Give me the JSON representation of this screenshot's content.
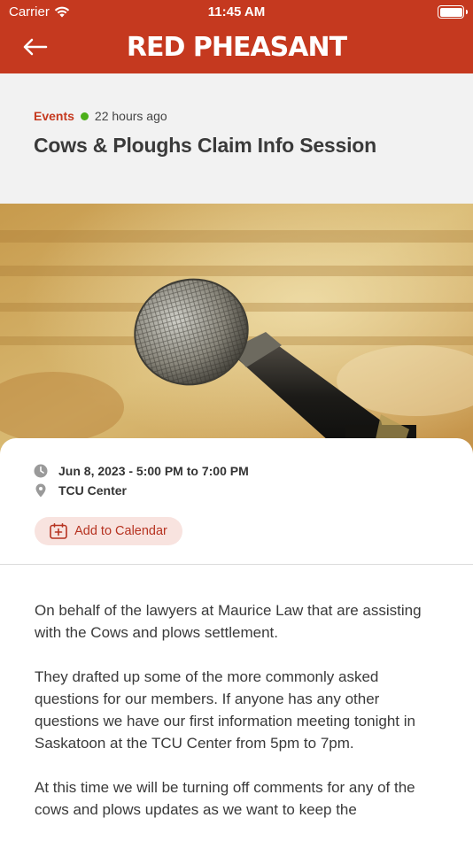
{
  "status_bar": {
    "carrier": "Carrier",
    "time": "11:45 AM"
  },
  "header": {
    "brand": "RED PHEASANT",
    "back_icon": "arrow-left-icon"
  },
  "article": {
    "category": "Events",
    "time_ago": "22 hours ago",
    "title": "Cows & Ploughs Claim Info Session"
  },
  "event": {
    "date_range": "Jun 8, 2023 - 5:00 PM to 7:00 PM",
    "location": "TCU Center",
    "add_to_calendar": "Add to Calendar"
  },
  "body": {
    "paragraphs": [
      "On behalf of the lawyers at Maurice Law that are assisting with the Cows and plows settlement.",
      "They drafted up some of the more commonly asked questions for our members. If anyone has any other questions we have our first information meeting tonight in Saskatoon at the TCU Center from 5pm to 7pm.",
      "At this time we will be turning off comments for any of the cows and plows updates as we want to keep the"
    ]
  },
  "colors": {
    "brand_red": "#c5391f",
    "online_green": "#4caf1a",
    "calendar_bg": "#f8e3df"
  }
}
